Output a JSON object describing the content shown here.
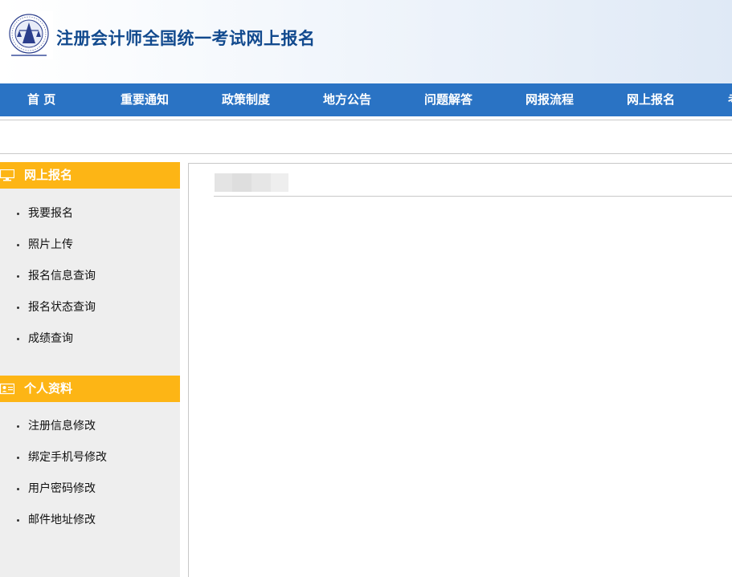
{
  "header": {
    "site_title": "注册会计师全国统一考试网上报名",
    "logo_icon": "cicpa-emblem-icon"
  },
  "nav": {
    "items": [
      {
        "label": "首 页"
      },
      {
        "label": "重要通知"
      },
      {
        "label": "政策制度"
      },
      {
        "label": "地方公告"
      },
      {
        "label": "问题解答"
      },
      {
        "label": "网报流程"
      },
      {
        "label": "网上报名"
      },
      {
        "label": "考"
      }
    ]
  },
  "sidebar": {
    "sections": [
      {
        "title": "网上报名",
        "icon": "computer-icon",
        "items": [
          {
            "label": "我要报名"
          },
          {
            "label": "照片上传"
          },
          {
            "label": "报名信息查询"
          },
          {
            "label": "报名状态查询"
          },
          {
            "label": "成绩查询"
          }
        ]
      },
      {
        "title": "个人资料",
        "icon": "id-card-icon",
        "items": [
          {
            "label": "注册信息修改"
          },
          {
            "label": "绑定手机号修改"
          },
          {
            "label": "用户密码修改"
          },
          {
            "label": "邮件地址修改"
          }
        ]
      }
    ]
  },
  "colors": {
    "nav_bg": "#2a73c4",
    "title_blue": "#124a8e",
    "section_head": "#fdb515",
    "sidebar_bg": "#eeeeee"
  }
}
